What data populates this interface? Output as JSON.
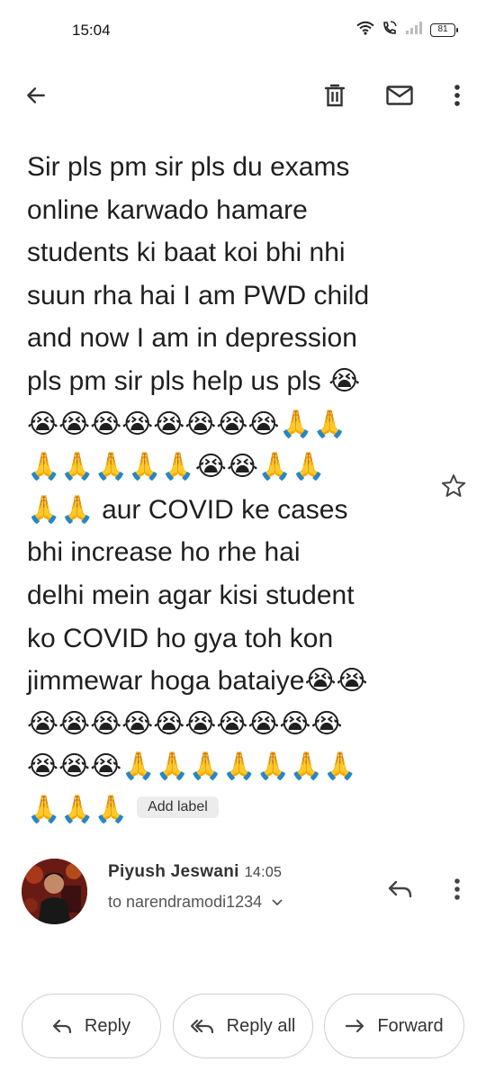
{
  "status_bar": {
    "time": "15:04",
    "battery": "81"
  },
  "toolbar": {
    "back_icon": "arrow-back-icon",
    "delete_icon": "trash-icon",
    "mark_unread_icon": "mail-icon",
    "more_icon": "more-vert-icon"
  },
  "email": {
    "subject_lines": {
      "l1": "Sir pls pm sir pls du exams",
      "l2": "online karwado hamare",
      "l3": "students ki baat koi bhi nhi",
      "l4": "suun rha hai I am PWD child",
      "l5": "and now I am in depression",
      "l6": "pls pm sir pls help us pls",
      "l6_emoji": "😭",
      "l7": "😭😭😭😭😭😭😭😭🙏🙏",
      "l8": "🙏🙏🙏🙏🙏😭😭🙏🙏",
      "l9_emoji": "🙏🙏",
      "l9": "aur COVID ke cases",
      "l10": "bhi increase ho rhe hai",
      "l11": "delhi mein agar kisi student",
      "l12": "ko COVID ho gya toh kon",
      "l13": "jimmewar hoga bataiye😭😭",
      "l14": "😭😭😭😭😭😭😭😭😭😭",
      "l15": "😭😭😭🙏🙏🙏🙏🙏🙏🙏",
      "l16": "🙏🙏🙏"
    },
    "label_chip": "Add label"
  },
  "sender": {
    "name": "Piyush Jeswani",
    "time": "14:05",
    "recipient": "to narendramodi1234"
  },
  "actions": {
    "reply": "Reply",
    "reply_all": "Reply all",
    "forward": "Forward"
  }
}
